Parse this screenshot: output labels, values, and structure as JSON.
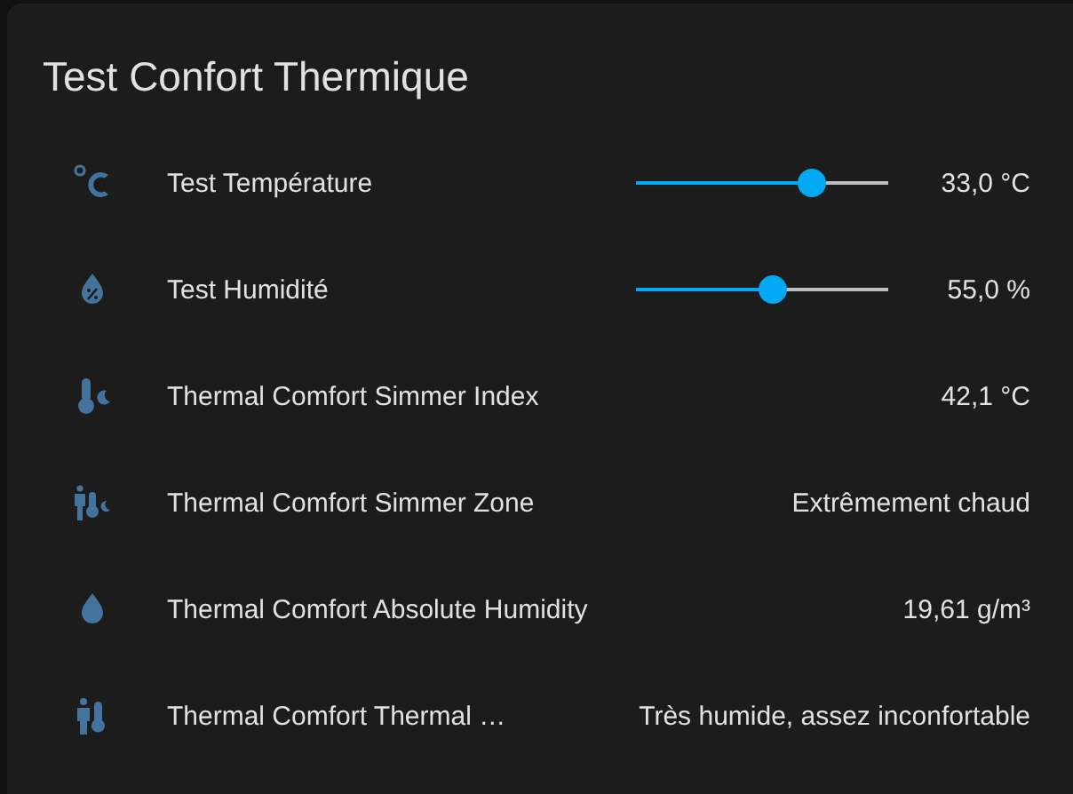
{
  "card": {
    "title": "Test Confort Thermique"
  },
  "rows": [
    {
      "kind": "slider",
      "name": "Test Température",
      "level": 0.7,
      "value": "33,0 °C"
    },
    {
      "kind": "slider",
      "name": "Test Humidité",
      "level": 0.54,
      "value": "55,0 %"
    },
    {
      "kind": "sensor",
      "name": "Thermal Comfort Simmer Index",
      "value": "42,1 °C"
    },
    {
      "kind": "sensor",
      "name": "Thermal Comfort Simmer Zone",
      "value": "Extrêmement chaud"
    },
    {
      "kind": "sensor",
      "name": "Thermal Comfort Absolute Humidity",
      "value": "19,61 g/m³"
    },
    {
      "kind": "sensor",
      "name": "Thermal Comfort Thermal …",
      "value": "Très humide, assez inconfortable"
    }
  ]
}
